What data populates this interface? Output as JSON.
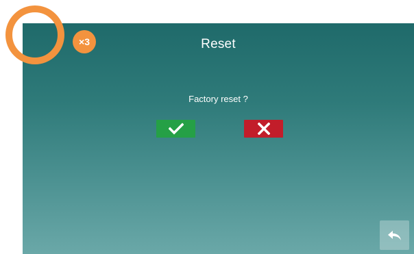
{
  "screen": {
    "title": "Reset",
    "question": "Factory reset ?",
    "confirm_icon": "check-icon",
    "cancel_icon": "x-icon",
    "back_icon": "return-arrow-icon"
  },
  "tap_hint": {
    "count_label": "×3"
  },
  "colors": {
    "confirm": "#25a046",
    "cancel": "#c21d2a",
    "accent_hint": "#f3933e",
    "background_top": "#1f6a6a",
    "background_bottom": "#6aa8a8"
  }
}
